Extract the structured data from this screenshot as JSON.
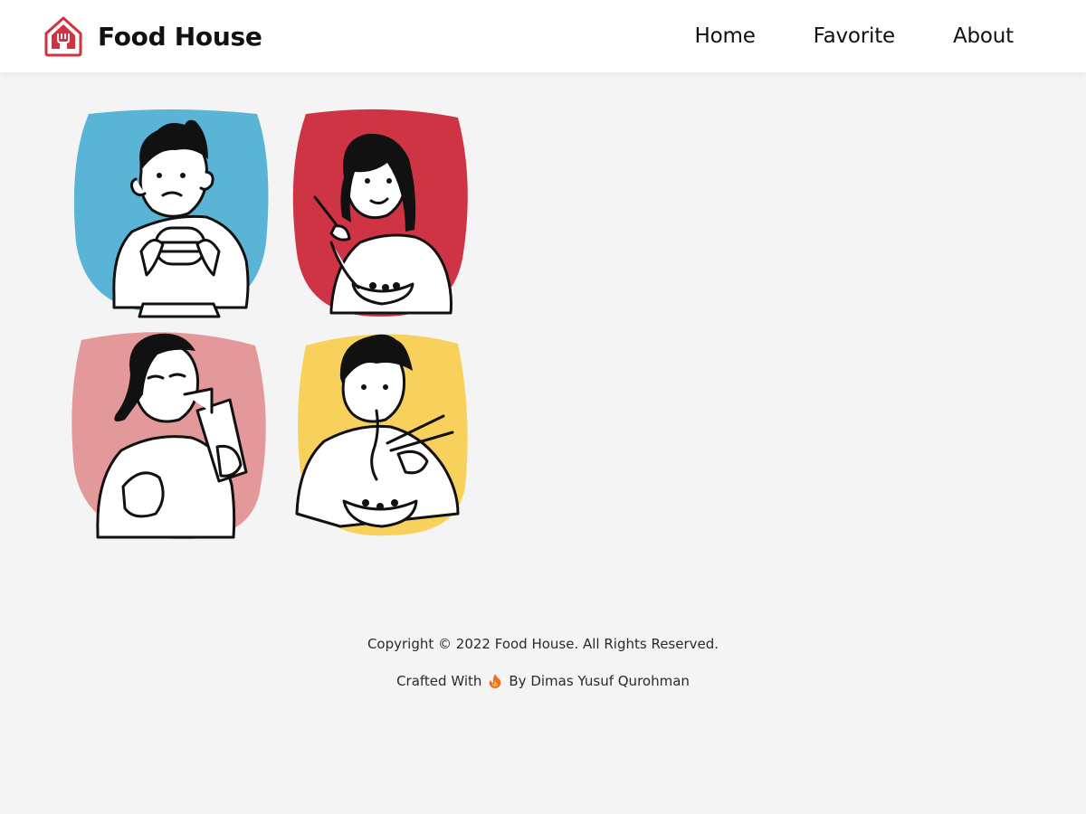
{
  "brand": {
    "name": "Food House",
    "logo_icon": "house-fork-icon",
    "accent": "#d0323f"
  },
  "nav": {
    "items": [
      {
        "label": "Home"
      },
      {
        "label": "Favorite"
      },
      {
        "label": "About"
      }
    ]
  },
  "hero": {
    "illustration": "people-eating-illustration",
    "panel_colors": [
      "#5ab4d6",
      "#cf3444",
      "#e3999a",
      "#f8d15c"
    ]
  },
  "footer": {
    "copyright": "Copyright © 2022 Food House. All Rights Reserved.",
    "crafted_prefix": "Crafted With",
    "crafted_icon": "fire-icon",
    "crafted_suffix": "By Dimas Yusuf Qurohman"
  }
}
